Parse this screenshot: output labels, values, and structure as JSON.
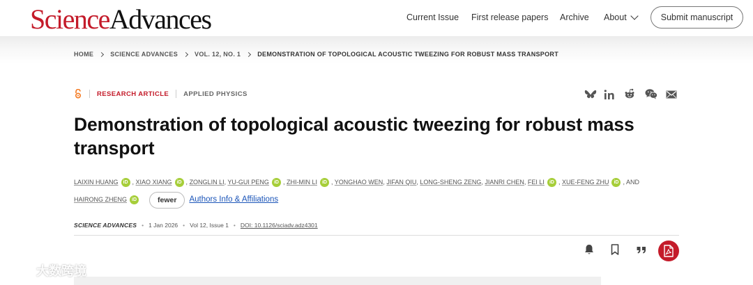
{
  "header": {
    "logo": {
      "part1": "Science",
      "part2": "Advances"
    },
    "nav": [
      {
        "label": "Current Issue"
      },
      {
        "label": "First release papers"
      },
      {
        "label": "Archive"
      },
      {
        "label": "About"
      }
    ],
    "submit_label": "Submit manuscript"
  },
  "breadcrumb": [
    "HOME",
    "SCIENCE ADVANCES",
    "VOL. 12, NO. 1",
    "DEMONSTRATION OF TOPOLOGICAL ACOUSTIC TWEEZING FOR ROBUST MASS TRANSPORT"
  ],
  "article": {
    "type": "RESEARCH ARTICLE",
    "subject": "APPLIED PHYSICS",
    "title": "Demonstration of topological acoustic tweezing for robust mass transport",
    "authors": [
      {
        "name": "LAIXIN HUANG",
        "orcid": true
      },
      {
        "name": "XIAO XIANG",
        "orcid": true
      },
      {
        "name": "ZONGLIN LI",
        "orcid": false
      },
      {
        "name": "YU-GUI PENG",
        "orcid": true
      },
      {
        "name": "ZHI-MIN LI",
        "orcid": true
      },
      {
        "name": "YONGHAO WEN",
        "orcid": false
      },
      {
        "name": "JIFAN QIU",
        "orcid": false
      },
      {
        "name": "LONG-SHENG ZENG",
        "orcid": false
      },
      {
        "name": "JIANRI CHEN",
        "orcid": false
      },
      {
        "name": "FEI LI",
        "orcid": true
      },
      {
        "name": "XUE-FENG ZHU",
        "orcid": true
      },
      {
        "name": "HAIRONG ZHENG",
        "orcid": true
      }
    ],
    "and_label": ", AND",
    "fewer_label": "fewer",
    "affiliations_label": "Authors Info & Affiliations",
    "citation": {
      "journal": "SCIENCE ADVANCES",
      "date": "1 Jan 2026",
      "volume": "Vol 12, Issue 1",
      "doi": "DOI: 10.1126/sciadv.adz4301"
    }
  },
  "share_icons": [
    "bluesky-icon",
    "linkedin-icon",
    "reddit-icon",
    "wechat-icon",
    "email-icon"
  ],
  "action_icons": [
    "bell-icon",
    "bookmark-icon",
    "quote-icon",
    "pdf-icon"
  ],
  "watermark": {
    "text": "大数跨境"
  },
  "colors": {
    "brand_red": "#c41b2a",
    "link_blue": "#1a54b8",
    "orcid_green": "#a6ce39"
  }
}
